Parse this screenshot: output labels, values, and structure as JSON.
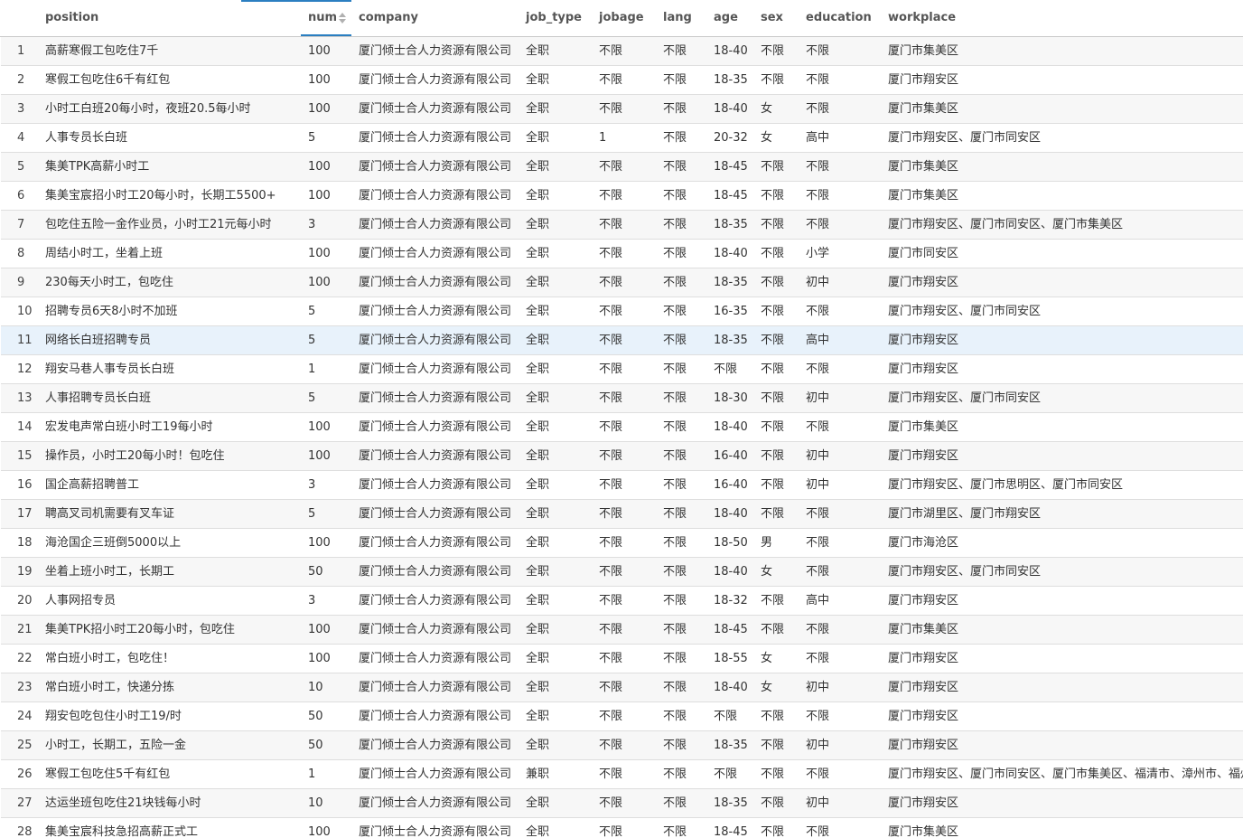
{
  "table": {
    "columns": [
      "position",
      "num",
      "company",
      "job_type",
      "jobage",
      "lang",
      "age",
      "sex",
      "education",
      "workplace"
    ],
    "rows": [
      {
        "idx": "1",
        "position": "高薪寒假工包吃住7千",
        "num": "100",
        "company": "厦门倾士合人力资源有限公司",
        "job_type": "全职",
        "jobage": "不限",
        "lang": "不限",
        "age": "18-40",
        "sex": "不限",
        "education": "不限",
        "workplace": "厦门市集美区"
      },
      {
        "idx": "2",
        "position": "寒假工包吃住6千有红包",
        "num": "100",
        "company": "厦门倾士合人力资源有限公司",
        "job_type": "全职",
        "jobage": "不限",
        "lang": "不限",
        "age": "18-35",
        "sex": "不限",
        "education": "不限",
        "workplace": "厦门市翔安区"
      },
      {
        "idx": "3",
        "position": "小时工白班20每小时，夜班20.5每小时",
        "num": "100",
        "company": "厦门倾士合人力资源有限公司",
        "job_type": "全职",
        "jobage": "不限",
        "lang": "不限",
        "age": "18-40",
        "sex": "女",
        "education": "不限",
        "workplace": "厦门市集美区"
      },
      {
        "idx": "4",
        "position": "人事专员长白班",
        "num": "5",
        "company": "厦门倾士合人力资源有限公司",
        "job_type": "全职",
        "jobage": "1",
        "lang": "不限",
        "age": "20-32",
        "sex": "女",
        "education": "高中",
        "workplace": "厦门市翔安区、厦门市同安区"
      },
      {
        "idx": "5",
        "position": "集美TPK高薪小时工",
        "num": "100",
        "company": "厦门倾士合人力资源有限公司",
        "job_type": "全职",
        "jobage": "不限",
        "lang": "不限",
        "age": "18-45",
        "sex": "不限",
        "education": "不限",
        "workplace": "厦门市集美区"
      },
      {
        "idx": "6",
        "position": "集美宝宸招小时工20每小时，长期工5500+",
        "num": "100",
        "company": "厦门倾士合人力资源有限公司",
        "job_type": "全职",
        "jobage": "不限",
        "lang": "不限",
        "age": "18-45",
        "sex": "不限",
        "education": "不限",
        "workplace": "厦门市集美区"
      },
      {
        "idx": "7",
        "position": "包吃住五险一金作业员，小时工21元每小时",
        "num": "3",
        "company": "厦门倾士合人力资源有限公司",
        "job_type": "全职",
        "jobage": "不限",
        "lang": "不限",
        "age": "18-35",
        "sex": "不限",
        "education": "不限",
        "workplace": "厦门市翔安区、厦门市同安区、厦门市集美区"
      },
      {
        "idx": "8",
        "position": "周结小时工，坐着上班",
        "num": "100",
        "company": "厦门倾士合人力资源有限公司",
        "job_type": "全职",
        "jobage": "不限",
        "lang": "不限",
        "age": "18-40",
        "sex": "不限",
        "education": "小学",
        "workplace": "厦门市同安区"
      },
      {
        "idx": "9",
        "position": "230每天小时工，包吃住",
        "num": "100",
        "company": "厦门倾士合人力资源有限公司",
        "job_type": "全职",
        "jobage": "不限",
        "lang": "不限",
        "age": "18-35",
        "sex": "不限",
        "education": "初中",
        "workplace": "厦门市翔安区"
      },
      {
        "idx": "10",
        "position": "招聘专员6天8小时不加班",
        "num": "5",
        "company": "厦门倾士合人力资源有限公司",
        "job_type": "全职",
        "jobage": "不限",
        "lang": "不限",
        "age": "16-35",
        "sex": "不限",
        "education": "不限",
        "workplace": "厦门市翔安区、厦门市同安区"
      },
      {
        "idx": "11",
        "position": "网络长白班招聘专员",
        "num": "5",
        "company": "厦门倾士合人力资源有限公司",
        "job_type": "全职",
        "jobage": "不限",
        "lang": "不限",
        "age": "18-35",
        "sex": "不限",
        "education": "高中",
        "workplace": "厦门市翔安区"
      },
      {
        "idx": "12",
        "position": "翔安马巷人事专员长白班",
        "num": "1",
        "company": "厦门倾士合人力资源有限公司",
        "job_type": "全职",
        "jobage": "不限",
        "lang": "不限",
        "age": "不限",
        "sex": "不限",
        "education": "不限",
        "workplace": "厦门市翔安区"
      },
      {
        "idx": "13",
        "position": "人事招聘专员长白班",
        "num": "5",
        "company": "厦门倾士合人力资源有限公司",
        "job_type": "全职",
        "jobage": "不限",
        "lang": "不限",
        "age": "18-30",
        "sex": "不限",
        "education": "初中",
        "workplace": "厦门市翔安区、厦门市同安区"
      },
      {
        "idx": "14",
        "position": "宏发电声常白班小时工19每小时",
        "num": "100",
        "company": "厦门倾士合人力资源有限公司",
        "job_type": "全职",
        "jobage": "不限",
        "lang": "不限",
        "age": "18-40",
        "sex": "不限",
        "education": "不限",
        "workplace": "厦门市集美区"
      },
      {
        "idx": "15",
        "position": "操作员，小时工20每小时！包吃住",
        "num": "100",
        "company": "厦门倾士合人力资源有限公司",
        "job_type": "全职",
        "jobage": "不限",
        "lang": "不限",
        "age": "16-40",
        "sex": "不限",
        "education": "初中",
        "workplace": "厦门市翔安区"
      },
      {
        "idx": "16",
        "position": "国企高薪招聘普工",
        "num": "3",
        "company": "厦门倾士合人力资源有限公司",
        "job_type": "全职",
        "jobage": "不限",
        "lang": "不限",
        "age": "16-40",
        "sex": "不限",
        "education": "初中",
        "workplace": "厦门市翔安区、厦门市思明区、厦门市同安区"
      },
      {
        "idx": "17",
        "position": "聘高叉司机需要有叉车证",
        "num": "5",
        "company": "厦门倾士合人力资源有限公司",
        "job_type": "全职",
        "jobage": "不限",
        "lang": "不限",
        "age": "18-40",
        "sex": "不限",
        "education": "不限",
        "workplace": "厦门市湖里区、厦门市翔安区"
      },
      {
        "idx": "18",
        "position": "海沧国企三班倒5000以上",
        "num": "100",
        "company": "厦门倾士合人力资源有限公司",
        "job_type": "全职",
        "jobage": "不限",
        "lang": "不限",
        "age": "18-50",
        "sex": "男",
        "education": "不限",
        "workplace": "厦门市海沧区"
      },
      {
        "idx": "19",
        "position": "坐着上班小时工，长期工",
        "num": "50",
        "company": "厦门倾士合人力资源有限公司",
        "job_type": "全职",
        "jobage": "不限",
        "lang": "不限",
        "age": "18-40",
        "sex": "女",
        "education": "不限",
        "workplace": "厦门市翔安区、厦门市同安区"
      },
      {
        "idx": "20",
        "position": "人事网招专员",
        "num": "3",
        "company": "厦门倾士合人力资源有限公司",
        "job_type": "全职",
        "jobage": "不限",
        "lang": "不限",
        "age": "18-32",
        "sex": "不限",
        "education": "高中",
        "workplace": "厦门市翔安区"
      },
      {
        "idx": "21",
        "position": "集美TPK招小时工20每小时，包吃住",
        "num": "100",
        "company": "厦门倾士合人力资源有限公司",
        "job_type": "全职",
        "jobage": "不限",
        "lang": "不限",
        "age": "18-45",
        "sex": "不限",
        "education": "不限",
        "workplace": "厦门市集美区"
      },
      {
        "idx": "22",
        "position": "常白班小时工，包吃住！",
        "num": "100",
        "company": "厦门倾士合人力资源有限公司",
        "job_type": "全职",
        "jobage": "不限",
        "lang": "不限",
        "age": "18-55",
        "sex": "女",
        "education": "不限",
        "workplace": "厦门市翔安区"
      },
      {
        "idx": "23",
        "position": "常白班小时工，快递分拣",
        "num": "10",
        "company": "厦门倾士合人力资源有限公司",
        "job_type": "全职",
        "jobage": "不限",
        "lang": "不限",
        "age": "18-40",
        "sex": "女",
        "education": "初中",
        "workplace": "厦门市翔安区"
      },
      {
        "idx": "24",
        "position": "翔安包吃包住小时工19/时",
        "num": "50",
        "company": "厦门倾士合人力资源有限公司",
        "job_type": "全职",
        "jobage": "不限",
        "lang": "不限",
        "age": "不限",
        "sex": "不限",
        "education": "不限",
        "workplace": "厦门市翔安区"
      },
      {
        "idx": "25",
        "position": "小时工，长期工，五险一金",
        "num": "50",
        "company": "厦门倾士合人力资源有限公司",
        "job_type": "全职",
        "jobage": "不限",
        "lang": "不限",
        "age": "18-35",
        "sex": "不限",
        "education": "初中",
        "workplace": "厦门市翔安区"
      },
      {
        "idx": "26",
        "position": "寒假工包吃住5千有红包",
        "num": "1",
        "company": "厦门倾士合人力资源有限公司",
        "job_type": "兼职",
        "jobage": "不限",
        "lang": "不限",
        "age": "不限",
        "sex": "不限",
        "education": "不限",
        "workplace": "厦门市翔安区、厦门市同安区、厦门市集美区、福清市、漳州市、福州"
      },
      {
        "idx": "27",
        "position": "达运坐班包吃住21块钱每小时",
        "num": "10",
        "company": "厦门倾士合人力资源有限公司",
        "job_type": "全职",
        "jobage": "不限",
        "lang": "不限",
        "age": "18-35",
        "sex": "不限",
        "education": "初中",
        "workplace": "厦门市翔安区"
      },
      {
        "idx": "28",
        "position": "集美宝宸科技急招高薪正式工",
        "num": "100",
        "company": "厦门倾士合人力资源有限公司",
        "job_type": "全职",
        "jobage": "不限",
        "lang": "不限",
        "age": "18-45",
        "sex": "不限",
        "education": "不限",
        "workplace": "厦门市集美区"
      }
    ]
  }
}
